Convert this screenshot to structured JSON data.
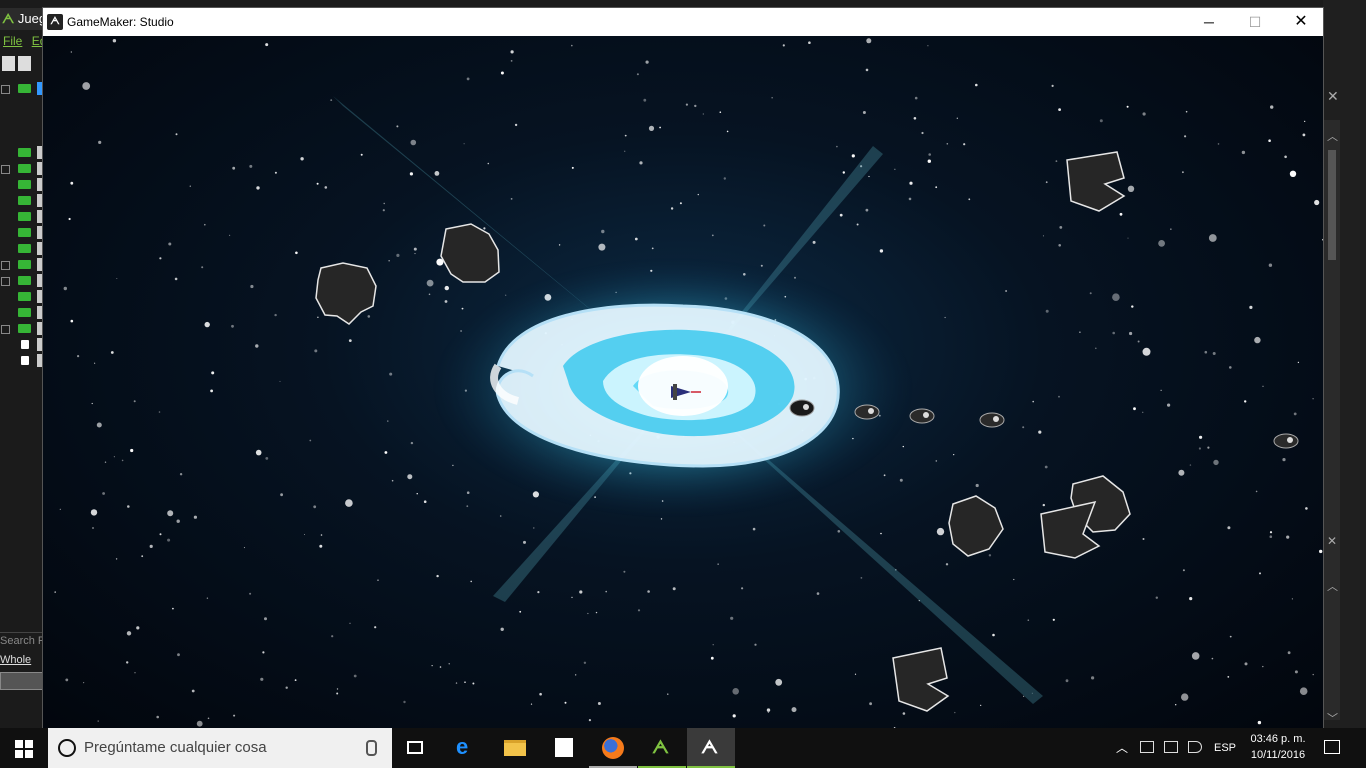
{
  "ide": {
    "title_prefix": "Juego",
    "menu_file": "File",
    "menu_edit": "Ed",
    "search_placeholder": "Search Fo",
    "whole_option": "Whole"
  },
  "game_window": {
    "title": "GameMaker: Studio",
    "minimize_symbol": "─",
    "maximize_symbol": "☐",
    "close_symbol": "✕"
  },
  "taskbar": {
    "search_placeholder": "Pregúntame cualquier cosa",
    "language": "ESP",
    "time": "03:46 p. m.",
    "date": "10/11/2016",
    "apps": [
      {
        "name": "task-view-icon"
      },
      {
        "name": "edge-icon"
      },
      {
        "name": "file-explorer-icon"
      },
      {
        "name": "store-icon"
      },
      {
        "name": "firefox-icon"
      },
      {
        "name": "gamemaker-green-icon"
      },
      {
        "name": "gamemaker-studio-icon"
      }
    ]
  },
  "colors": {
    "gamemaker_green": "#7fc241",
    "galaxy_core": "#e8fbff",
    "galaxy_glow": "#39c3e8",
    "asteroid": "#262626"
  }
}
